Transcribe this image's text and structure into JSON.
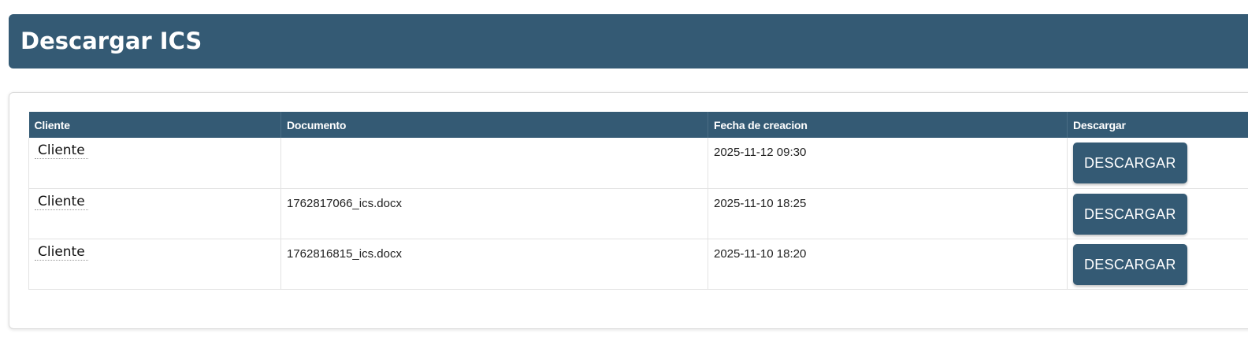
{
  "header": {
    "title": "Descargar ICS"
  },
  "table": {
    "columns": [
      "Cliente",
      "Documento",
      "Fecha de creacion",
      "Descargar"
    ],
    "rows": [
      {
        "cliente": "Cliente",
        "documento": "",
        "fecha": "2025-11-12 09:30",
        "accion": "DESCARGAR"
      },
      {
        "cliente": "Cliente",
        "documento": "1762817066_ics.docx",
        "fecha": "2025-11-10 18:25",
        "accion": "DESCARGAR"
      },
      {
        "cliente": "Cliente",
        "documento": "1762816815_ics.docx",
        "fecha": "2025-11-10 18:20",
        "accion": "DESCARGAR"
      }
    ]
  },
  "colors": {
    "header_bg": "#345a74",
    "button_bg": "#345a74"
  }
}
